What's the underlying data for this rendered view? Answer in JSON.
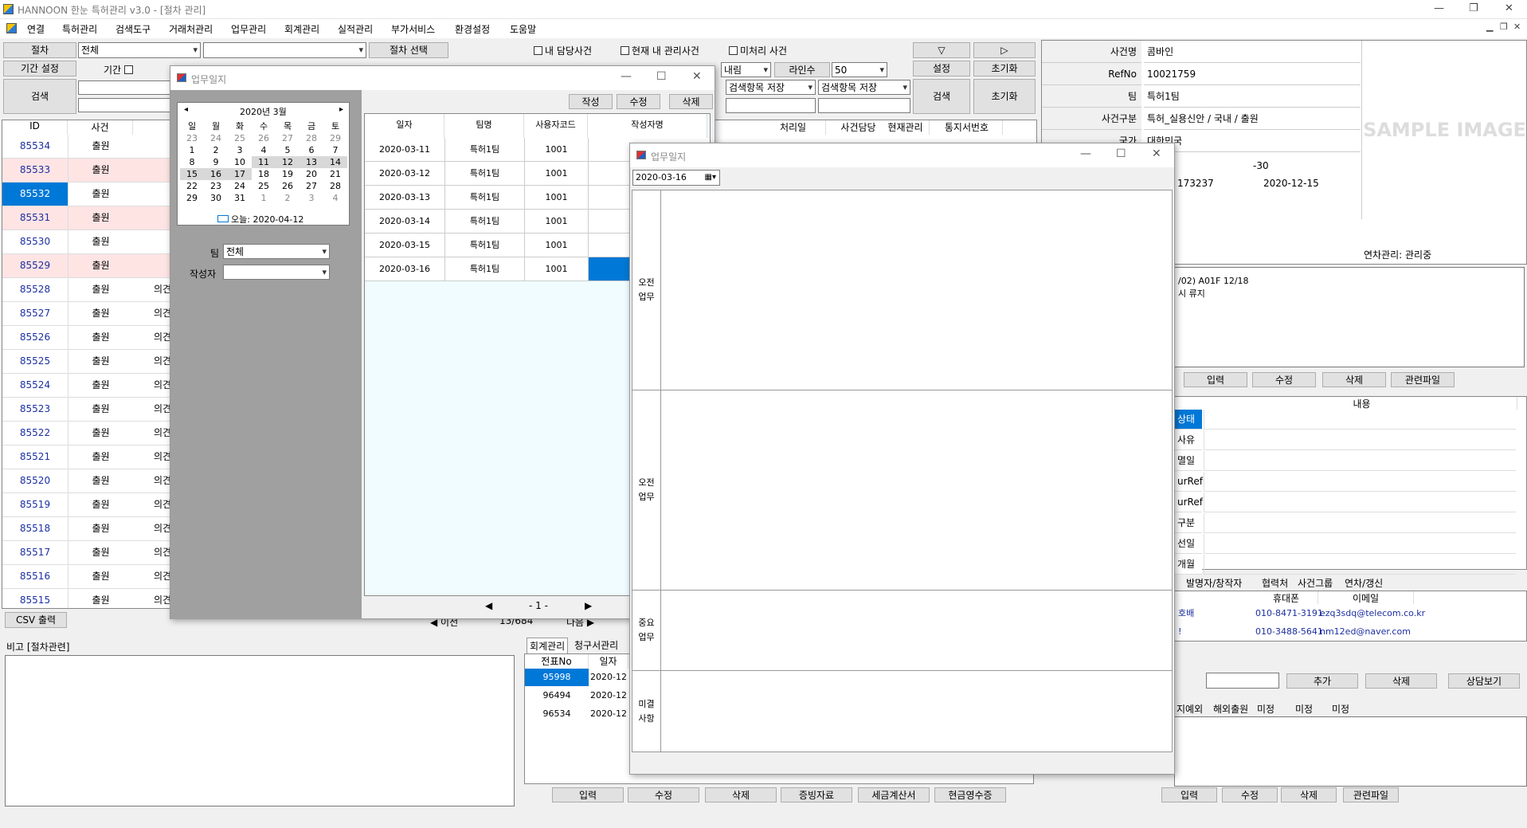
{
  "app": {
    "title": "HANNOON 한눈 특허관리 v3.0 - [절차 관리]"
  },
  "menu": [
    "연결",
    "특허관리",
    "검색도구",
    "거래처관리",
    "업무관리",
    "회계관리",
    "실적관리",
    "부가서비스",
    "환경설정",
    "도움말"
  ],
  "filters": {
    "procedure_label": "절차",
    "procedure_value": "전체",
    "select_procedure_btn": "절차 선택",
    "my_case": "내 담당사건",
    "current_managed": "현재 내 관리사건",
    "unprocessed": "미처리 사건",
    "period_setting": "기간 설정",
    "period_label": "기간",
    "sort_desc": "내림",
    "lines_label": "라인수",
    "lines_value": "50",
    "search_label": "검색",
    "save_search1": "검색항목 저장",
    "save_search2": "검색항목 저장",
    "settings": "설정",
    "reset": "초기화",
    "search_btn": "검색",
    "reset2": "초기화",
    "arrow_down": "▽",
    "arrow_right": "▷"
  },
  "case_table": {
    "headers": [
      "ID",
      "사건"
    ],
    "rows": [
      {
        "id": "85534",
        "type": "출원",
        "extra": ""
      },
      {
        "id": "85533",
        "type": "출원",
        "extra": ""
      },
      {
        "id": "85532",
        "type": "출원",
        "extra": ""
      },
      {
        "id": "85531",
        "type": "출원",
        "extra": ""
      },
      {
        "id": "85530",
        "type": "출원",
        "extra": ""
      },
      {
        "id": "85529",
        "type": "출원",
        "extra": ""
      },
      {
        "id": "85528",
        "type": "출원",
        "extra": "의견"
      },
      {
        "id": "85527",
        "type": "출원",
        "extra": "의견"
      },
      {
        "id": "85526",
        "type": "출원",
        "extra": "의견"
      },
      {
        "id": "85525",
        "type": "출원",
        "extra": "의견"
      },
      {
        "id": "85524",
        "type": "출원",
        "extra": "의견"
      },
      {
        "id": "85523",
        "type": "출원",
        "extra": "의견"
      },
      {
        "id": "85522",
        "type": "출원",
        "extra": "의견"
      },
      {
        "id": "85521",
        "type": "출원",
        "extra": "의견"
      },
      {
        "id": "85520",
        "type": "출원",
        "extra": "의견"
      },
      {
        "id": "85519",
        "type": "출원",
        "extra": "의견"
      },
      {
        "id": "85518",
        "type": "출원",
        "extra": "의견"
      },
      {
        "id": "85517",
        "type": "출원",
        "extra": "의견"
      },
      {
        "id": "85516",
        "type": "출원",
        "extra": "의견"
      },
      {
        "id": "85515",
        "type": "출원",
        "extra": "의견"
      }
    ]
  },
  "mid_headers": [
    "처리일",
    "사건담당",
    "현재관리",
    "통지서번호"
  ],
  "csv_btn": "CSV 출력",
  "pager": {
    "prev": "◀ 이전",
    "info": "13/684",
    "next": "다음 ▶"
  },
  "remarks": {
    "label": "비고 [절차관련]"
  },
  "accounting": {
    "tabs": [
      "회계관리",
      "청구서관리"
    ],
    "headers": [
      "전표No",
      "일자"
    ],
    "rows": [
      {
        "no": "95998",
        "date": "2020-12"
      },
      {
        "no": "96494",
        "date": "2020-12"
      },
      {
        "no": "96534",
        "date": "2020-12"
      }
    ],
    "buttons": [
      "입력",
      "수정",
      "삭제",
      "증빙자료",
      "세금계산서",
      "현금영수증"
    ]
  },
  "case_info": {
    "rows": [
      {
        "label": "사건명",
        "value": "콤바인"
      },
      {
        "label": "RefNo",
        "value": "10021759"
      },
      {
        "label": "팀",
        "value": "특허1팀"
      },
      {
        "label": "사건구분",
        "value": "특허_실용신안 / 국내 / 출원"
      },
      {
        "label": "국가",
        "value": "대한민국"
      }
    ],
    "partial1": "-30",
    "partial2": "173237",
    "date2": "2020-12-15",
    "annuity": "연차관리: 관리중",
    "sample": "SAMPLE IMAGE"
  },
  "notes": {
    "line1": "/02) A01F 12/18",
    "line2": "시 류지"
  },
  "right_btns1": [
    "입력",
    "수정",
    "삭제",
    "관련파일"
  ],
  "content": {
    "header": "내용",
    "items": [
      "상태",
      "사유",
      "멸일",
      "urRef",
      "urRef",
      "구분",
      "선일",
      "개월"
    ]
  },
  "contact": {
    "tabs": [
      "발명자/창작자",
      "협력처",
      "사건그룹",
      "연차/갱신"
    ],
    "headers": [
      "휴대폰",
      "이메일"
    ],
    "rows": [
      {
        "name": "호배",
        "phone": "010-8471-3191",
        "email": "ezq3sdq@telecom.co.kr"
      },
      {
        "name": "!",
        "phone": "010-3488-5641",
        "email": "nm12ed@naver.com"
      }
    ],
    "buttons": [
      "추가",
      "삭제",
      "상담보기"
    ]
  },
  "bottom_tabs": [
    "지예외",
    "해외출원",
    "미정",
    "미정",
    "미정"
  ],
  "right_btns2": [
    "입력",
    "수정",
    "삭제",
    "관련파일"
  ],
  "worklog1": {
    "title": "업무일지",
    "cal_title": "2020년 3월",
    "weekdays": [
      "일",
      "월",
      "화",
      "수",
      "목",
      "금",
      "토"
    ],
    "weeks": [
      [
        "23",
        "24",
        "25",
        "26",
        "27",
        "28",
        "29"
      ],
      [
        "1",
        "2",
        "3",
        "4",
        "5",
        "6",
        "7"
      ],
      [
        "8",
        "9",
        "10",
        "11",
        "12",
        "13",
        "14"
      ],
      [
        "15",
        "16",
        "17",
        "18",
        "19",
        "20",
        "21"
      ],
      [
        "22",
        "23",
        "24",
        "25",
        "26",
        "27",
        "28"
      ],
      [
        "29",
        "30",
        "31",
        "1",
        "2",
        "3",
        "4"
      ]
    ],
    "today": "오늘: 2020-04-12",
    "team_label": "팀",
    "team_value": "전체",
    "author_label": "작성자",
    "buttons": [
      "작성",
      "수정",
      "삭제"
    ],
    "headers": [
      "일자",
      "팀명",
      "사용자코드",
      "작성자명"
    ],
    "rows": [
      {
        "date": "2020-03-11",
        "team": "특허1팀",
        "code": "1001"
      },
      {
        "date": "2020-03-12",
        "team": "특허1팀",
        "code": "1001"
      },
      {
        "date": "2020-03-13",
        "team": "특허1팀",
        "code": "1001"
      },
      {
        "date": "2020-03-14",
        "team": "특허1팀",
        "code": "1001"
      },
      {
        "date": "2020-03-15",
        "team": "특허1팀",
        "code": "1001"
      },
      {
        "date": "2020-03-16",
        "team": "특허1팀",
        "code": "1001"
      }
    ],
    "pager": "- 1 -"
  },
  "worklog2": {
    "title": "업무일지",
    "date": "2020-03-16",
    "sections": [
      "오전\n업무",
      "오전\n업무",
      "중요\n업무",
      "미결\n사항"
    ]
  },
  "colors": {
    "selected": "#0078d7",
    "pink": "#ffe4e4",
    "id_blue": "#1c2fa0"
  }
}
